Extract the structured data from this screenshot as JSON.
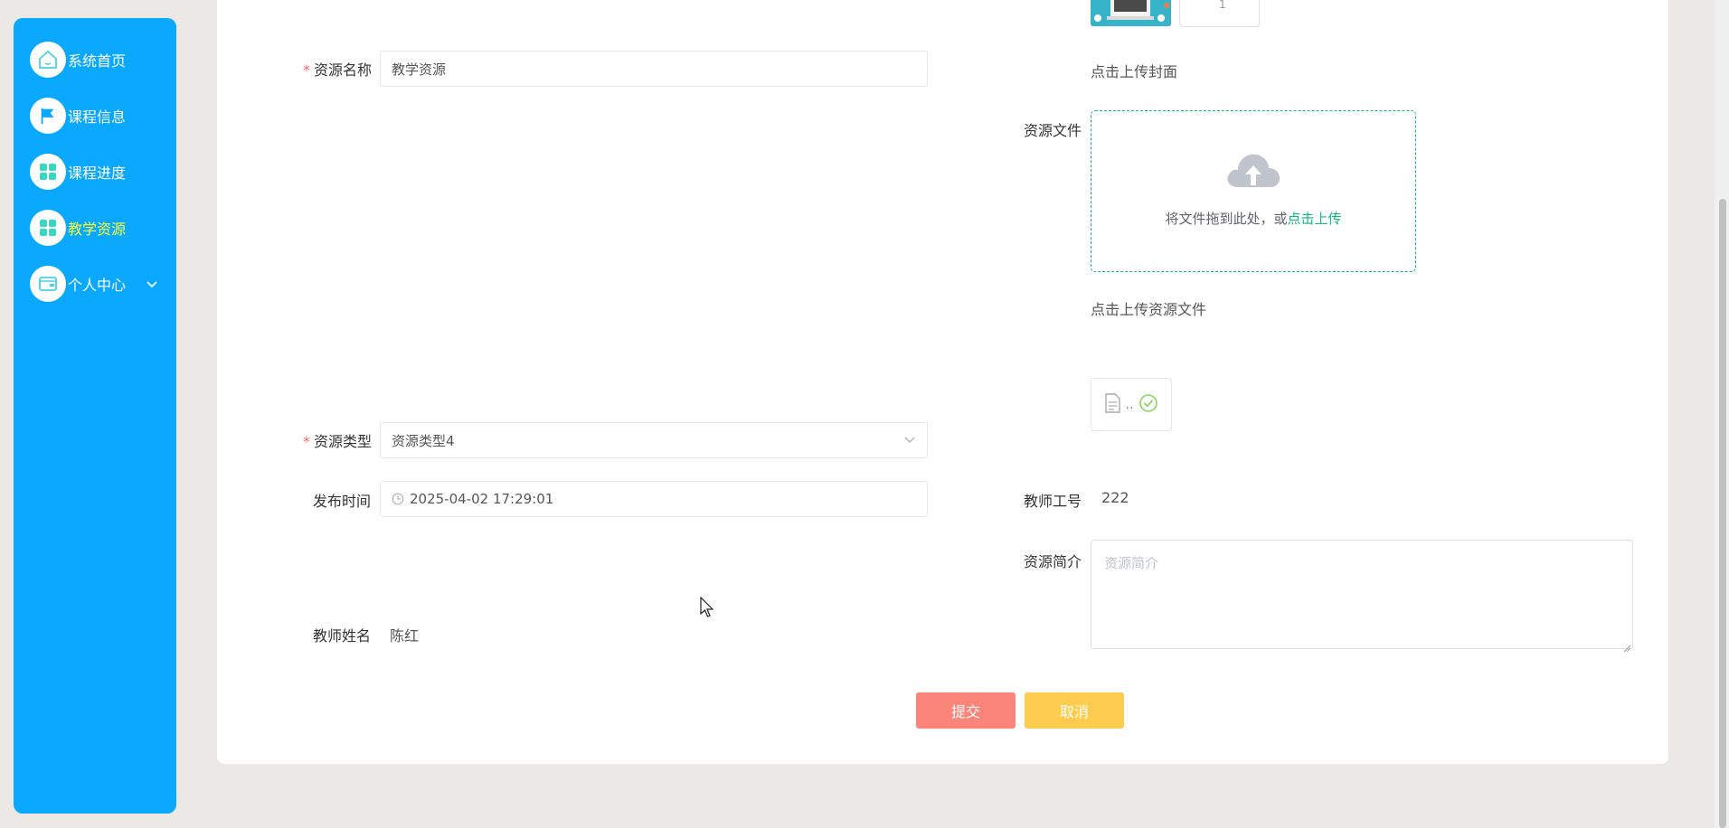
{
  "sidebar": {
    "items": [
      {
        "label": "系统首页",
        "icon": "home-icon"
      },
      {
        "label": "课程信息",
        "icon": "flag-icon"
      },
      {
        "label": "课程进度",
        "icon": "grid-icon"
      },
      {
        "label": "教学资源",
        "icon": "grid-icon",
        "active": true
      },
      {
        "label": "个人中心",
        "icon": "wallet-icon",
        "expandable": true
      }
    ]
  },
  "form": {
    "resource_name": {
      "label": "资源名称",
      "required": true,
      "value": "教学资源"
    },
    "cover": {
      "hint": "点击上传封面",
      "counter": "1"
    },
    "resource_file": {
      "label": "资源文件",
      "drop_text": "将文件拖到此处，或",
      "drop_link": "点击上传",
      "hint": "点击上传资源文件",
      "uploaded_name": ".."
    },
    "resource_type": {
      "label": "资源类型",
      "required": true,
      "value": "资源类型4"
    },
    "publish_time": {
      "label": "发布时间",
      "value": "2025-04-02 17:29:01"
    },
    "teacher_id": {
      "label": "教师工号",
      "value": "222"
    },
    "resource_intro": {
      "label": "资源简介",
      "placeholder": "资源简介"
    },
    "teacher_name": {
      "label": "教师姓名",
      "value": "陈红"
    },
    "submit_label": "提交",
    "cancel_label": "取消"
  },
  "colors": {
    "sidebar_bg": "#0aa8ff",
    "active_nav_text": "#f5ff3a",
    "upload_accent": "#17b37b",
    "submit_bg": "#fc857a",
    "cancel_bg": "#fecd4f",
    "required_mark": "#f56c6c"
  }
}
